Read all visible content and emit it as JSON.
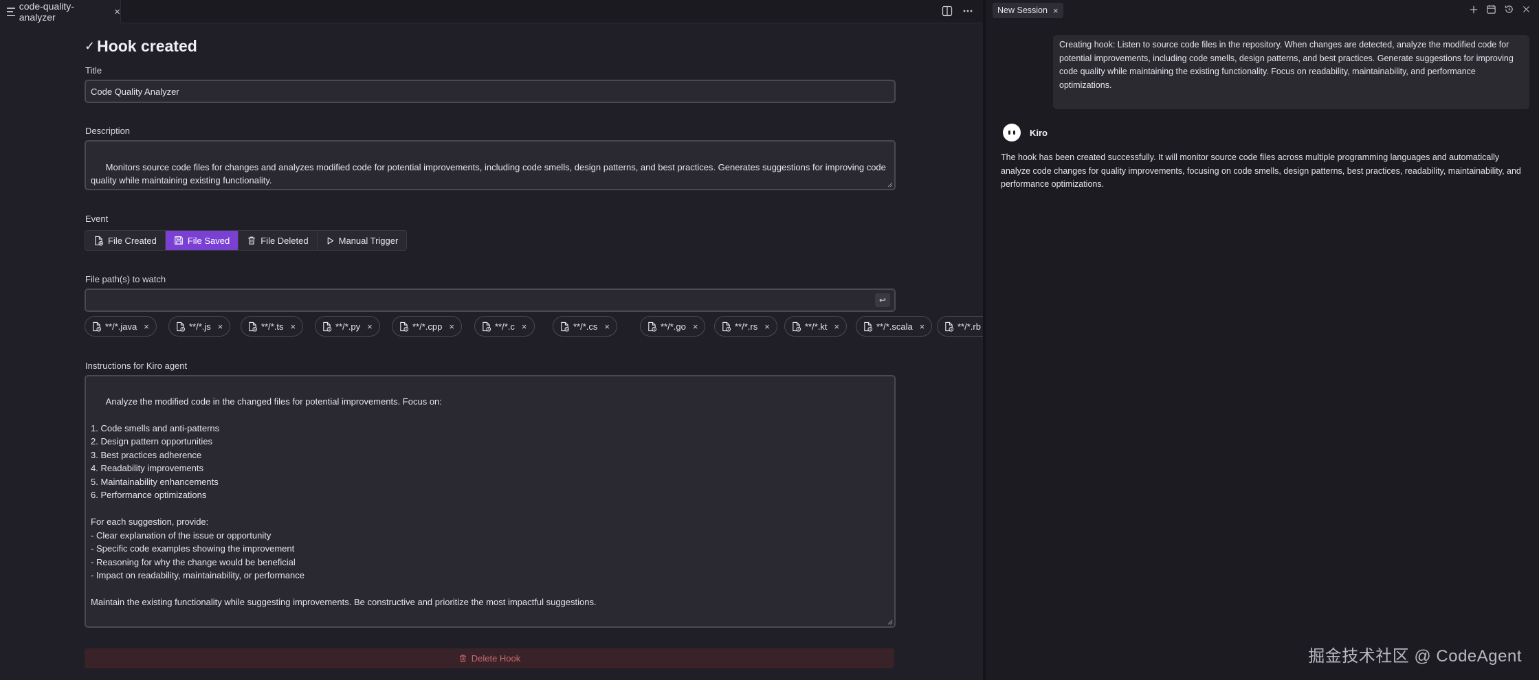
{
  "editor": {
    "tab_title": "code-quality-analyzer",
    "tab_close": "×"
  },
  "form": {
    "heading_check": "✓",
    "heading": "Hook created",
    "title_label": "Title",
    "title_value": "Code Quality Analyzer",
    "description_label": "Description",
    "description_value": "Monitors source code files for changes and analyzes modified code for potential improvements, including code smells, design patterns, and best practices. Generates suggestions for improving code quality while maintaining existing functionality.",
    "event_label": "Event",
    "events": [
      {
        "label": "File Created",
        "icon": "file-plus-icon",
        "active": false
      },
      {
        "label": "File Saved",
        "icon": "save-icon",
        "active": true
      },
      {
        "label": "File Deleted",
        "icon": "trash-icon",
        "active": false
      },
      {
        "label": "Manual Trigger",
        "icon": "play-icon",
        "active": false
      }
    ],
    "paths_label": "File path(s) to watch",
    "paths_input_value": "",
    "enter_symbol": "↩",
    "patterns": [
      "**/*.java",
      "**/*.js",
      "**/*.ts",
      "**/*.py",
      "**/*.cpp",
      "**/*.c",
      "**/*.cs",
      "**/*.go",
      "**/*.rs",
      "**/*.kt",
      "**/*.scala",
      "**/*.rb"
    ],
    "chip_close": "×",
    "instructions_label": "Instructions for Kiro agent",
    "instructions_value": "Analyze the modified code in the changed files for potential improvements. Focus on:\n\n1. Code smells and anti-patterns\n2. Design pattern opportunities\n3. Best practices adherence\n4. Readability improvements\n5. Maintainability enhancements\n6. Performance optimizations\n\nFor each suggestion, provide:\n- Clear explanation of the issue or opportunity\n- Specific code examples showing the improvement\n- Reasoning for why the change would be beneficial\n- Impact on readability, maintainability, or performance\n\nMaintain the existing functionality while suggesting improvements. Be constructive and prioritize the most impactful suggestions.",
    "delete_label": "Delete Hook"
  },
  "chat": {
    "session_tab": "New Session",
    "session_close": "×",
    "user_message": "Creating hook: Listen to source code files in the repository. When changes are detected, analyze the modified code for potential improvements, including code smells, design patterns, and best practices. Generate suggestions for improving code quality while maintaining the existing functionality. Focus on readability, maintainability, and performance optimizations.",
    "agent_name": "Kiro",
    "agent_message": "The hook has been created successfully. It will monitor source code files across multiple programming languages and automatically analyze code changes for quality improvements, focusing on code smells, design patterns, best practices, readability, maintainability, and performance optimizations.",
    "watermark": "掘金技术社区 @ CodeAgent"
  },
  "colors": {
    "accent": "#7a3fd3",
    "danger_text": "#c46a72",
    "background": "#201f27"
  }
}
